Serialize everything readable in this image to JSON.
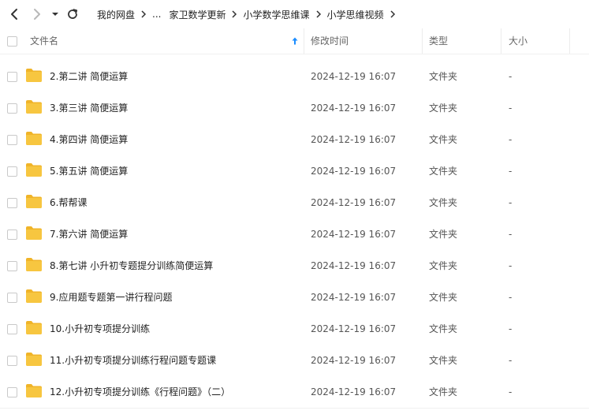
{
  "toolbar": {
    "back_icon": "chevron-left-icon",
    "forward_icon": "chevron-right-icon",
    "dropdown_icon": "caret-down-icon",
    "refresh_icon": "refresh-icon"
  },
  "breadcrumb": [
    "我的网盘",
    "...",
    "家卫数学更新",
    "小学数学思维课",
    "小学思维视频"
  ],
  "columns": {
    "name": "文件名",
    "mtime": "修改时间",
    "type": "类型",
    "size": "大小",
    "sort_icon": "sort-up-arrow-icon"
  },
  "colors": {
    "accent": "#1a8cff",
    "folder_body": "#f7c640",
    "folder_tab": "#f0b429"
  },
  "files": [
    {
      "name": "2.第二讲 简便运算",
      "mtime": "2024-12-19 16:07",
      "type": "文件夹",
      "size": "-"
    },
    {
      "name": "3.第三讲 简便运算",
      "mtime": "2024-12-19 16:07",
      "type": "文件夹",
      "size": "-"
    },
    {
      "name": "4.第四讲 简便运算",
      "mtime": "2024-12-19 16:07",
      "type": "文件夹",
      "size": "-"
    },
    {
      "name": "5.第五讲 简便运算",
      "mtime": "2024-12-19 16:07",
      "type": "文件夹",
      "size": "-"
    },
    {
      "name": "6.帮帮课",
      "mtime": "2024-12-19 16:07",
      "type": "文件夹",
      "size": "-"
    },
    {
      "name": "7.第六讲 简便运算",
      "mtime": "2024-12-19 16:07",
      "type": "文件夹",
      "size": "-"
    },
    {
      "name": "8.第七讲 小升初专题提分训练简便运算",
      "mtime": "2024-12-19 16:07",
      "type": "文件夹",
      "size": "-"
    },
    {
      "name": "9.应用题专题第一讲行程问题",
      "mtime": "2024-12-19 16:07",
      "type": "文件夹",
      "size": "-"
    },
    {
      "name": "10.小升初专项提分训练",
      "mtime": "2024-12-19 16:07",
      "type": "文件夹",
      "size": "-"
    },
    {
      "name": "11.小升初专项提分训练行程问题专题课",
      "mtime": "2024-12-19 16:07",
      "type": "文件夹",
      "size": "-"
    },
    {
      "name": "12.小升初专项提分训练《行程问题》（二）",
      "mtime": "2024-12-19 16:07",
      "type": "文件夹",
      "size": "-"
    }
  ]
}
